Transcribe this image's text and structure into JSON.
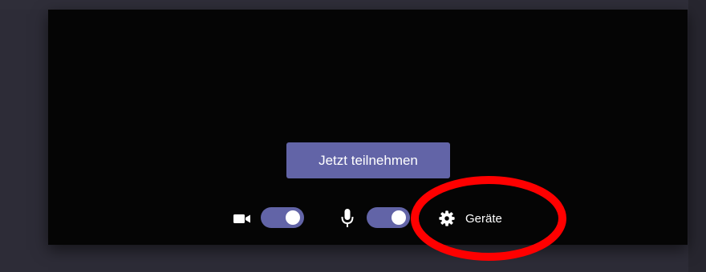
{
  "join": {
    "label": "Jetzt teilnehmen"
  },
  "camera": {
    "icon": "video-camera-icon",
    "toggle_on": true
  },
  "microphone": {
    "icon": "microphone-icon",
    "toggle_on": true
  },
  "devices": {
    "icon": "gear-icon",
    "label": "Geräte"
  },
  "colors": {
    "accent": "#6264a7",
    "annotation": "#ff0000",
    "preview_bg": "#050505",
    "page_bg": "#2d2c37"
  }
}
